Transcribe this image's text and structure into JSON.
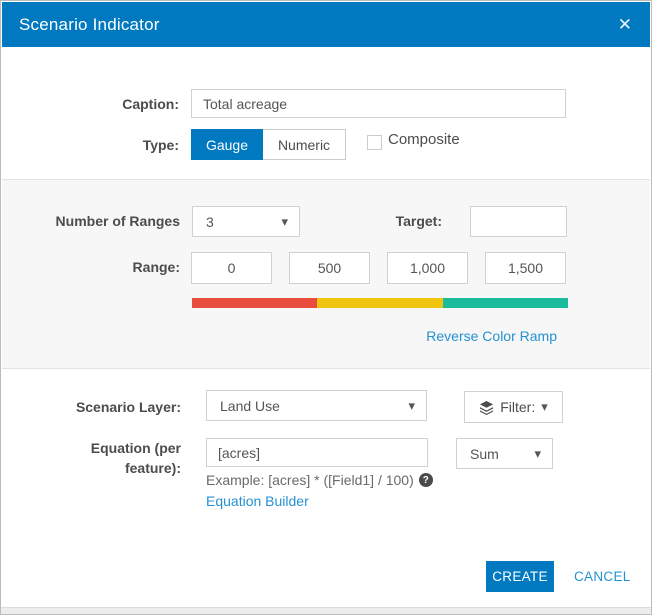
{
  "dialog": {
    "title": "Scenario Indicator"
  },
  "icons": {
    "close": "✕",
    "caret": "▾",
    "help": "?"
  },
  "caption": {
    "label": "Caption:",
    "value": "Total acreage"
  },
  "type_row": {
    "label": "Type:",
    "gauge": "Gauge",
    "numeric": "Numeric",
    "selected": "Gauge",
    "composite": "Composite",
    "composite_checked": false
  },
  "ranges": {
    "number_label": "Number of Ranges",
    "number_value": "3",
    "target_label": "Target:",
    "target_value": "",
    "range_label": "Range:",
    "range_values": [
      "0",
      "500",
      "1,000",
      "1,500"
    ],
    "ramp_colors": [
      "#e74c3c",
      "#f1c40f",
      "#1abc9c"
    ],
    "reverse_link": "Reverse Color Ramp"
  },
  "layer_row": {
    "label": "Scenario Layer:",
    "value": "Land Use",
    "filter_label": "Filter:"
  },
  "equation_row": {
    "label_line1": "Equation (per",
    "label_line2": "feature):",
    "value": "[acres]",
    "aggregation": "Sum",
    "example": "Example: [acres] * ([Field1] / 100)",
    "builder_link": "Equation Builder"
  },
  "footer": {
    "create": "CREATE",
    "cancel": "CANCEL"
  },
  "colors": {
    "accent": "#0079c1",
    "link": "#2492d2"
  }
}
